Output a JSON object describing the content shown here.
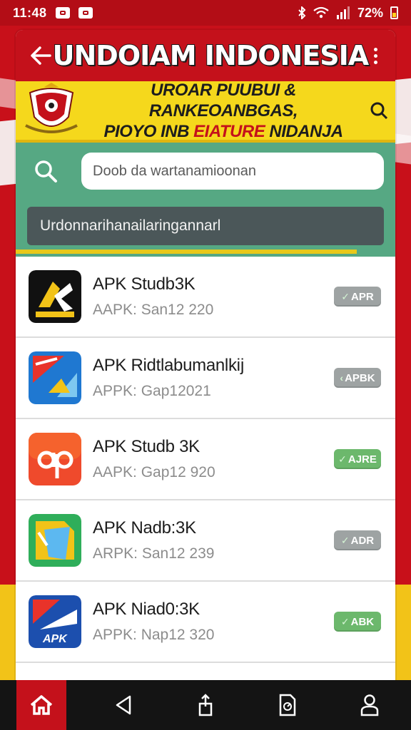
{
  "status_bar": {
    "time": "11:48",
    "battery": "72%"
  },
  "toolbar": {
    "title": "UNDOIAM INDONESIA"
  },
  "banner": {
    "line1": "UROAR PUUBUI & RANKEOANBGAS,",
    "line2_prefix": "PIOYO INB ",
    "line2_accent": "EIATURE",
    "line2_suffix": " NIDANJA"
  },
  "search": {
    "placeholder": "Doob da wartanamioonan"
  },
  "category": {
    "label": "Urdonnarihanailaringannarl"
  },
  "apps": [
    {
      "name": "APK Studb3K",
      "version": "AAPK: San12 220",
      "badge": "APR",
      "icon": "black-yellow-k-icon"
    },
    {
      "name": "APK Ridtlabumanlkĳ",
      "version": "APPK: Gap12021",
      "badge": "APBK",
      "icon": "blue-red-app-icon"
    },
    {
      "name": "APK Studb 3K",
      "version": "AAPK: Gap12 920",
      "badge": "AJRE",
      "icon": "orange-ap-icon"
    },
    {
      "name": "APK Nadb:3K",
      "version": "ARPK: San12 239",
      "badge": "ADR",
      "icon": "green-file-icon"
    },
    {
      "name": "APK Niad0:3K",
      "version": "APPK: Nap12 320",
      "badge": "ABK",
      "icon": "blue-apk-icon"
    }
  ],
  "colors": {
    "primary_red": "#c4111b",
    "banner_yellow": "#f5d81c",
    "search_green": "#56a883",
    "category_dark": "#4b5759",
    "badge_gray": "#9ea3a3",
    "badge_green": "#6cb86c"
  },
  "bottom_nav": [
    "home-icon",
    "back-triangle-icon",
    "share-icon",
    "file-icon",
    "profile-icon"
  ]
}
